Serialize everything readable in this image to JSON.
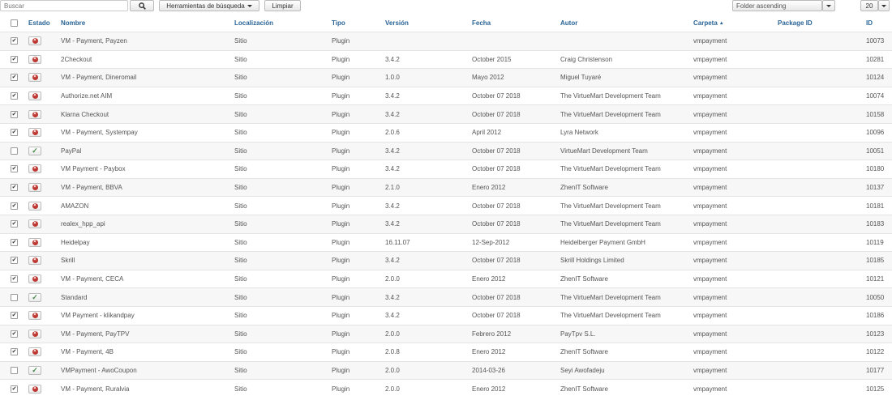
{
  "toolbar": {
    "search_placeholder": "Buscar",
    "search_button_icon": "search-icon",
    "tools_label": "Herramientas de búsqueda",
    "clear_label": "Limpiar",
    "sort_value": "Folder ascending",
    "limit_value": "20"
  },
  "columns": {
    "state": "Estado",
    "name": "Nombre",
    "location": "Localización",
    "type": "Tipo",
    "version": "Versión",
    "date": "Fecha",
    "author": "Autor",
    "folder": "Carpeta",
    "folder_sort": "▲",
    "package": "Package ID",
    "id": "ID"
  },
  "rows": [
    {
      "checked": true,
      "enabled": false,
      "name": "VM - Payment, Payzen",
      "location": "Sitio",
      "type": "Plugin",
      "version": "",
      "date": "",
      "author": "",
      "folder": "vmpayment",
      "package": "",
      "id": "10073"
    },
    {
      "checked": true,
      "enabled": false,
      "name": "2Checkout",
      "location": "Sitio",
      "type": "Plugin",
      "version": "3.4.2",
      "date": "October 2015",
      "author": "Craig Christenson",
      "folder": "vmpayment",
      "package": "",
      "id": "10281"
    },
    {
      "checked": true,
      "enabled": false,
      "name": "VM - Payment, Dineromail",
      "location": "Sitio",
      "type": "Plugin",
      "version": "1.0.0",
      "date": "Mayo 2012",
      "author": "Miguel Tuyaré",
      "folder": "vmpayment",
      "package": "",
      "id": "10124"
    },
    {
      "checked": true,
      "enabled": false,
      "name": "Authorize.net AIM",
      "location": "Sitio",
      "type": "Plugin",
      "version": "3.4.2",
      "date": "October 07 2018",
      "author": "The VirtueMart Development Team",
      "folder": "vmpayment",
      "package": "",
      "id": "10074"
    },
    {
      "checked": true,
      "enabled": false,
      "name": "Klarna Checkout",
      "location": "Sitio",
      "type": "Plugin",
      "version": "3.4.2",
      "date": "October 07 2018",
      "author": "The VirtueMart Development Team",
      "folder": "vmpayment",
      "package": "",
      "id": "10158"
    },
    {
      "checked": true,
      "enabled": false,
      "name": "VM - Payment, Systempay",
      "location": "Sitio",
      "type": "Plugin",
      "version": "2.0.6",
      "date": "April 2012",
      "author": "Lyra Network",
      "folder": "vmpayment",
      "package": "",
      "id": "10096"
    },
    {
      "checked": false,
      "enabled": true,
      "name": "PayPal",
      "location": "Sitio",
      "type": "Plugin",
      "version": "3.4.2",
      "date": "October 07 2018",
      "author": "VirtueMart Development Team",
      "folder": "vmpayment",
      "package": "",
      "id": "10051"
    },
    {
      "checked": true,
      "enabled": false,
      "name": "VM Payment - Paybox",
      "location": "Sitio",
      "type": "Plugin",
      "version": "3.4.2",
      "date": "October 07 2018",
      "author": "The VirtueMart Development Team",
      "folder": "vmpayment",
      "package": "",
      "id": "10180"
    },
    {
      "checked": true,
      "enabled": false,
      "name": "VM - Payment, BBVA",
      "location": "Sitio",
      "type": "Plugin",
      "version": "2.1.0",
      "date": "Enero 2012",
      "author": "ZhenIT Software",
      "folder": "vmpayment",
      "package": "",
      "id": "10137"
    },
    {
      "checked": true,
      "enabled": false,
      "name": "AMAZON",
      "location": "Sitio",
      "type": "Plugin",
      "version": "3.4.2",
      "date": "October 07 2018",
      "author": "The VirtueMart Development Team",
      "folder": "vmpayment",
      "package": "",
      "id": "10181"
    },
    {
      "checked": true,
      "enabled": false,
      "name": "realex_hpp_api",
      "location": "Sitio",
      "type": "Plugin",
      "version": "3.4.2",
      "date": "October 07 2018",
      "author": "The VirtueMart Development Team",
      "folder": "vmpayment",
      "package": "",
      "id": "10183"
    },
    {
      "checked": true,
      "enabled": false,
      "name": "Heidelpay",
      "location": "Sitio",
      "type": "Plugin",
      "version": "16.11.07",
      "date": "12-Sep-2012",
      "author": "Heidelberger Payment GmbH",
      "folder": "vmpayment",
      "package": "",
      "id": "10119"
    },
    {
      "checked": true,
      "enabled": false,
      "name": "Skrill",
      "location": "Sitio",
      "type": "Plugin",
      "version": "3.4.2",
      "date": "October 07 2018",
      "author": "Skrill Holdings Limited",
      "folder": "vmpayment",
      "package": "",
      "id": "10185"
    },
    {
      "checked": true,
      "enabled": false,
      "name": "VM - Payment, CECA",
      "location": "Sitio",
      "type": "Plugin",
      "version": "2.0.0",
      "date": "Enero 2012",
      "author": "ZhenIT Software",
      "folder": "vmpayment",
      "package": "",
      "id": "10121"
    },
    {
      "checked": false,
      "enabled": true,
      "name": "Standard",
      "location": "Sitio",
      "type": "Plugin",
      "version": "3.4.2",
      "date": "October 07 2018",
      "author": "The VirtueMart Development Team",
      "folder": "vmpayment",
      "package": "",
      "id": "10050"
    },
    {
      "checked": true,
      "enabled": false,
      "name": "VM Payment - klikandpay",
      "location": "Sitio",
      "type": "Plugin",
      "version": "3.4.2",
      "date": "October 07 2018",
      "author": "The VirtueMart Development Team",
      "folder": "vmpayment",
      "package": "",
      "id": "10186"
    },
    {
      "checked": true,
      "enabled": false,
      "name": "VM - Payment, PayTPV",
      "location": "Sitio",
      "type": "Plugin",
      "version": "2.0.0",
      "date": "Febrero 2012",
      "author": "PayTpv S.L.",
      "folder": "vmpayment",
      "package": "",
      "id": "10123"
    },
    {
      "checked": true,
      "enabled": false,
      "name": "VM - Payment, 4B",
      "location": "Sitio",
      "type": "Plugin",
      "version": "2.0.8",
      "date": "Enero 2012",
      "author": "ZhenIT Software",
      "folder": "vmpayment",
      "package": "",
      "id": "10122"
    },
    {
      "checked": false,
      "enabled": true,
      "name": "VMPayment - AwoCoupon",
      "location": "Sitio",
      "type": "Plugin",
      "version": "2.0.0",
      "date": "2014-03-26",
      "author": "Seyi Awofadeju",
      "folder": "vmpayment",
      "package": "",
      "id": "10177"
    },
    {
      "checked": true,
      "enabled": false,
      "name": "VM - Payment, Ruralvia",
      "location": "Sitio",
      "type": "Plugin",
      "version": "2.0.0",
      "date": "Enero 2012",
      "author": "ZhenIT Software",
      "folder": "vmpayment",
      "package": "",
      "id": "10125"
    }
  ]
}
